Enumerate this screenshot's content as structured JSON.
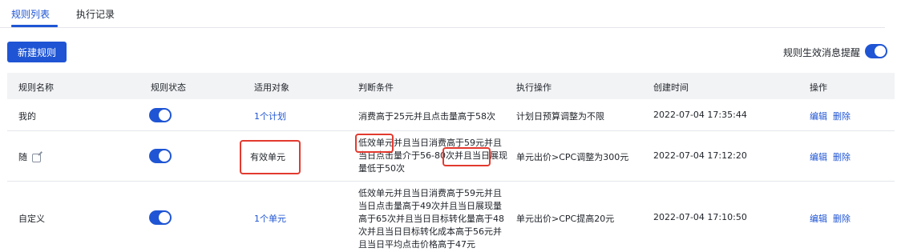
{
  "tabs": [
    {
      "label": "规则列表",
      "active": true
    },
    {
      "label": "执行记录",
      "active": false
    }
  ],
  "toolbar": {
    "new_rule_label": "新建规则",
    "notify_label": "规则生效消息提醒",
    "notify_enabled": true
  },
  "table": {
    "columns": [
      "规则名称",
      "规则状态",
      "适用对象",
      "判断条件",
      "执行操作",
      "创建时间",
      "操作"
    ],
    "rows": [
      {
        "name": "我的",
        "status_on": true,
        "target": "1个计划",
        "condition": "消费高于25元并且点击量高于58次",
        "action": "计划日预算调整为不限",
        "created": "2022-07-04 17:35:44",
        "edit": "编辑",
        "delete": "删除"
      },
      {
        "name": "随",
        "status_on": true,
        "target": "有效单元",
        "condition": "低效单元并且当日消费高于59元并且当日点击量介于56-80次并且当日展现量低于50次",
        "action": "单元出价>CPC调整为300元",
        "created": "2022-07-04 17:12:20",
        "edit": "编辑",
        "delete": "删除"
      },
      {
        "name": "自定义",
        "status_on": true,
        "target": "1个单元",
        "condition": "低效单元并且当日消费高于59元并且当日点击量高于49次并且当日展现量高于65次并且当日目标转化量高于48次并且当日目标转化成本高于56元并且当日平均点击价格高于47元",
        "action": "单元出价>CPC提高20元",
        "created": "2022-07-04 17:10:50",
        "edit": "编辑",
        "delete": "删除"
      }
    ]
  },
  "colors": {
    "accent": "#1f55d4",
    "highlight": "#e33a2f",
    "header_bg": "#f2f3f5"
  }
}
